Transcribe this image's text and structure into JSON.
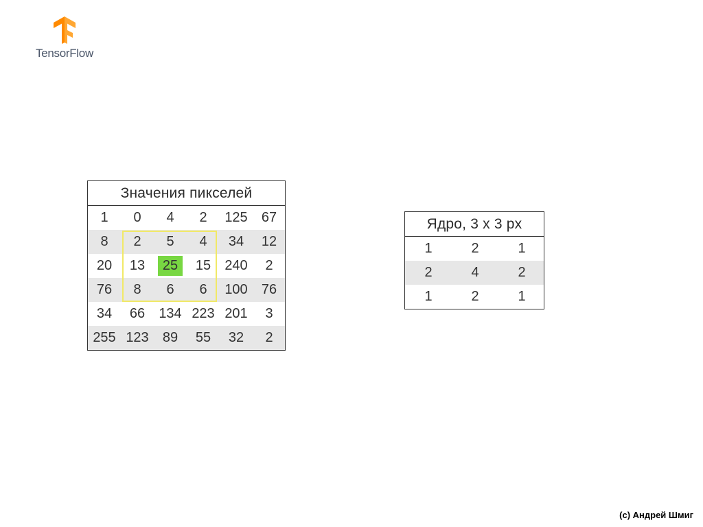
{
  "brand": {
    "name": "TensorFlow"
  },
  "pixels": {
    "title": "Значения пикселей",
    "rows": [
      [
        1,
        0,
        4,
        2,
        125,
        67
      ],
      [
        8,
        2,
        5,
        4,
        34,
        12
      ],
      [
        20,
        13,
        25,
        15,
        240,
        2
      ],
      [
        76,
        8,
        6,
        6,
        100,
        76
      ],
      [
        34,
        66,
        134,
        223,
        201,
        3
      ],
      [
        255,
        123,
        89,
        55,
        32,
        2
      ]
    ],
    "highlight_window": {
      "row_start": 1,
      "col_start": 1,
      "rows": 3,
      "cols": 3
    },
    "highlight_center": {
      "row": 2,
      "col": 2
    }
  },
  "kernel": {
    "title": "Ядро, 3 x 3 px",
    "rows": [
      [
        1,
        2,
        1
      ],
      [
        2,
        4,
        2
      ],
      [
        1,
        2,
        1
      ]
    ]
  },
  "copyright": "(c) Андрей Шмиг",
  "colors": {
    "brand_orange": "#ff8a00",
    "highlight_border": "#f1e967",
    "highlight_fill": "#78d742",
    "stripe": "#e7e7e7"
  }
}
